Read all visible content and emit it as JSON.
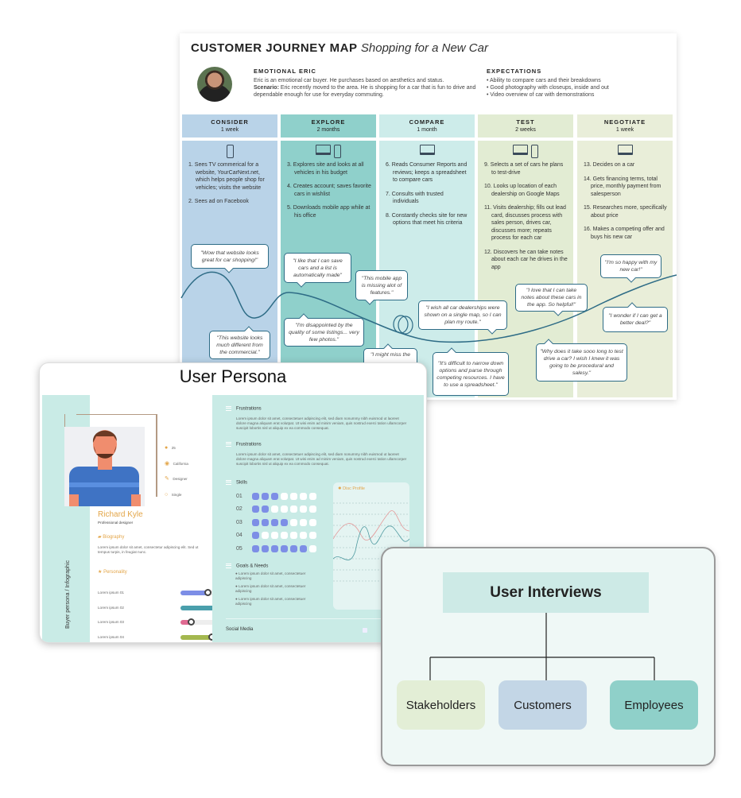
{
  "journey": {
    "title": "CUSTOMER JOURNEY MAP",
    "subtitle": "Shopping for a New Car",
    "persona_name": "EMOTIONAL ERIC",
    "persona_desc": "Eric is an emotional car buyer. He purchases based on aesthetics and status.",
    "scenario_label": "Scenario:",
    "scenario": "Eric recently moved to the area. He is shopping for a car that is fun to drive and dependable enough for use for everyday commuting.",
    "expectations_title": "EXPECTATIONS",
    "expectations": [
      "• Ability to compare cars and their breakdowns",
      "• Good photography with closeups, inside and out",
      "• Video overview of car with demonstrations"
    ],
    "stages": [
      {
        "name": "CONSIDER",
        "duration": "1 week",
        "color": "#b9d3e8",
        "devices": [
          "phone"
        ],
        "steps": [
          "1. Sees TV commerical for a website, YourCarNext.net, which helps people shop for vehicles; visits the website",
          "2. Sees ad on Facebook"
        ]
      },
      {
        "name": "EXPLORE",
        "duration": "2 months",
        "color": "#8fd0cb",
        "devices": [
          "laptop",
          "phone"
        ],
        "steps": [
          "3. Explores site and looks at all vehicles in his budget",
          "4. Creates account; saves favorite cars in wishlist",
          "5. Downloads mobile app while at his office"
        ]
      },
      {
        "name": "COMPARE",
        "duration": "1 month",
        "color": "#cdecea",
        "devices": [
          "laptop"
        ],
        "steps": [
          "6. Reads Consumer Reports and reviews; keeps a spreadsheet to compare cars",
          "7. Consults with trusted individuals",
          "8. Constantly checks site for new options that meet his criteria"
        ]
      },
      {
        "name": "TEST",
        "duration": "2 weeks",
        "color": "#e2ecd3",
        "devices": [
          "laptop",
          "phone"
        ],
        "steps": [
          "9. Selects a set of cars he plans to test-drive",
          "10. Looks up location of each dealership on Google Maps",
          "11. Visits dealership; fills out lead card, discusses process with sales person, drives car, discusses more; repeats process for each car",
          "12. Discovers he can take notes about each car he drives in the app"
        ]
      },
      {
        "name": "NEGOTIATE",
        "duration": "1 week",
        "color": "#e9eed9",
        "devices": [
          "laptop"
        ],
        "steps": [
          "13. Decides on a car",
          "14. Gets financing terms, total price, monthly payment from salesperson",
          "15. Researches more, specifically about price",
          "16. Makes a competing offer and buys his new car"
        ]
      }
    ],
    "quotes": [
      "\"Wow that website looks great for car shopping!\"",
      "\"I like that I can save cars and a list is automatically made\"",
      "\"This mobile app is missing alot of features.\"",
      "\"This website looks much different from the commercial.\"",
      "\"I'm disappointed by the quality of some listings... very few photos.\"",
      "\"I wish all car dealerships were shown on a single map, so I can plan my route.\"",
      "\"I love that I can take notes about these cars in the app. So helpful!\"",
      "\"I'm so happy with my new car!\"",
      "\"I wonder if I can get a better deal?\"",
      "\"Why does it take sooo long to test drive a car? I wish I knew it was going to be procedural and salesy.\"",
      "\"It's difficult to narrow down options and parse through competing resources. I have to use a spreadsheet.\"",
      "\"I might miss the"
    ]
  },
  "persona": {
    "title": "User Persona",
    "side_label": "Buyer persona / Infographic",
    "name": "Richard Kyle",
    "role": "Professional designer",
    "facts": [
      {
        "icon": "person-icon",
        "text": "25"
      },
      {
        "icon": "location-icon",
        "text": "California"
      },
      {
        "icon": "tools-icon",
        "text": "Designer"
      },
      {
        "icon": "ring-icon",
        "text": "Single"
      }
    ],
    "biography_title": "Biography",
    "biography": "Lorem ipsum dolor sit amet, consectetur adipiscing elit. Sed ut tempus turpis, in feugiat nunc.",
    "personality_title": "Personality",
    "personality": [
      {
        "label": "Lorem ipsum 01",
        "value": 0.38,
        "color": "#7d8ee6"
      },
      {
        "label": "Lorem ipsum 02",
        "value": 0.78,
        "color": "#4a9fac"
      },
      {
        "label": "Lorem ipsum 03",
        "value": 0.15,
        "color": "#e06a92"
      },
      {
        "label": "Lorem ipsum 04",
        "value": 0.43,
        "color": "#a4b84f"
      }
    ],
    "frustrations": [
      {
        "title": "Frustrations",
        "text": "Lorem ipsum dolor sit amet, consectetuer adipiscing elit, sed diam nonummy nibh euismod ut laoreet dolore magna aliquam erat volutpat. Ut wisi enim ad minim veniam, quis nostrud exerci tation ullamcorper suscipit lobortis nisl ut aliquip ex ea commodo consequat."
      },
      {
        "title": "Frustrations",
        "text": "Lorem ipsum dolor sit amet, consectetuer adipiscing elit, sed diam nonummy nibh euismod ut laoreet dolore magna aliquam erat volutpat. Ut wisi enim ad minim veniam, quis nostrud exerci tation ullamcorper suscipit lobortis nisl ut aliquip ex ea commodo consequat."
      }
    ],
    "skills_title": "Skills",
    "skills": [
      {
        "label": "01",
        "level": 3
      },
      {
        "label": "02",
        "level": 2
      },
      {
        "label": "03",
        "level": 4
      },
      {
        "label": "04",
        "level": 1
      },
      {
        "label": "05",
        "level": 6
      }
    ],
    "skills_max": 7,
    "goals_title": "Goals & Needs",
    "goals": [
      "Lorem ipsum dolor sit amet, consectetuer adipiscing",
      "Lorem ipsum dolor sit amet, consectetuer adipiscing",
      "Lorem ipsum dolor sit amet, consectetuer adipiscing"
    ],
    "disc_title": "Disc Profile",
    "social_title": "Social Media"
  },
  "interviews": {
    "title": "User Interviews",
    "children": [
      {
        "label": "Stakeholders",
        "color": "#e3eed6"
      },
      {
        "label": "Customers",
        "color": "#c3d6e6"
      },
      {
        "label": "Employees",
        "color": "#8fd0c9"
      }
    ],
    "title_color": "#cdeae6"
  }
}
